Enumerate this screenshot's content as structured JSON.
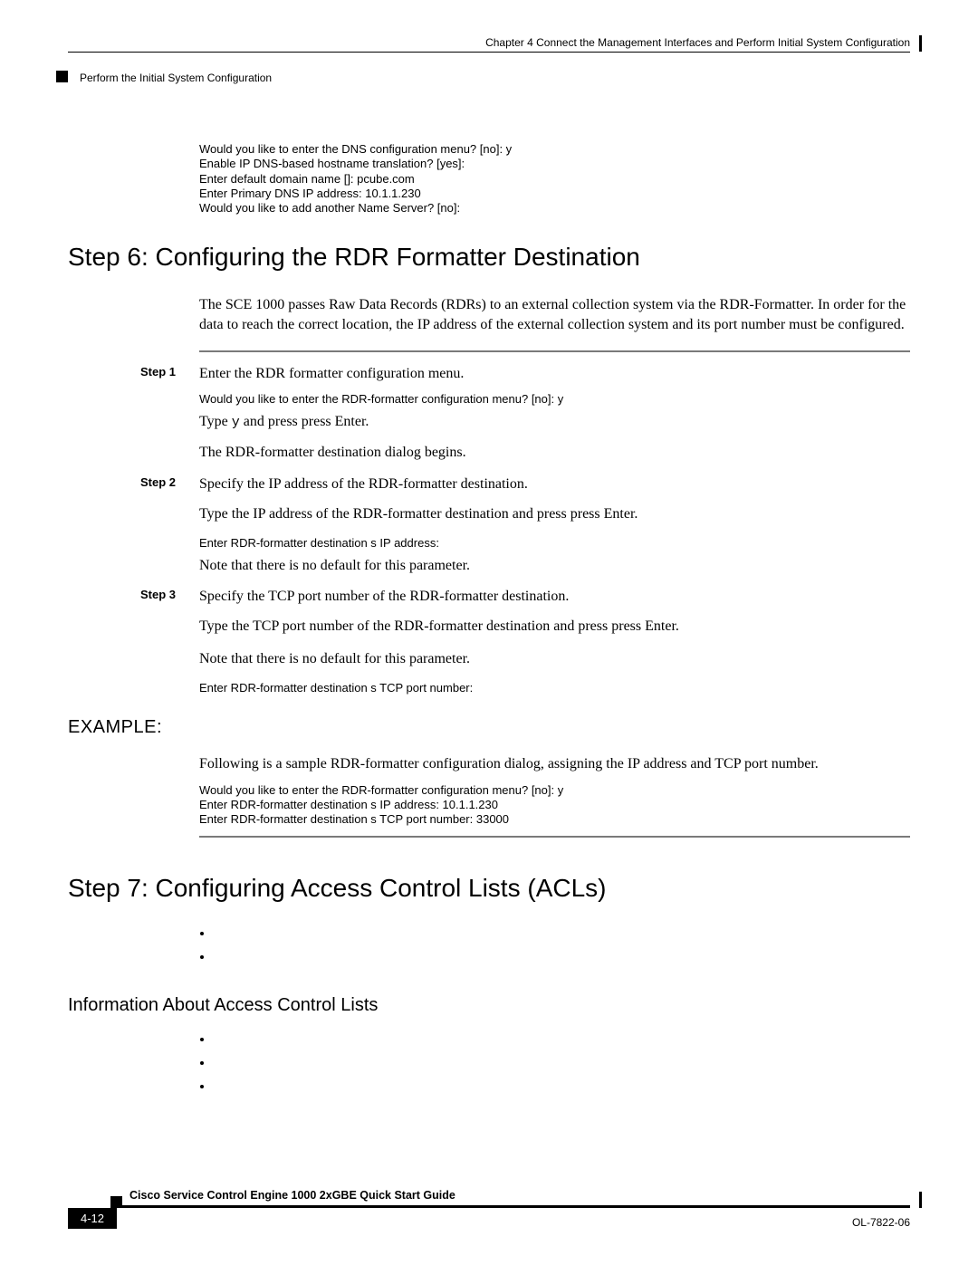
{
  "header": {
    "chapter": "Chapter 4    Connect the Management Interfaces and Perform Initial System Configuration",
    "section": "Perform the Initial System Configuration"
  },
  "intro_code": "Would you like to enter the DNS configuration menu? [no]: y\nEnable IP DNS-based hostname translation? [yes]:\nEnter default domain name []: pcube.com\nEnter Primary DNS IP address: 10.1.1.230\nWould you like to add another Name Server? [no]:",
  "step6": {
    "title": "Step 6: Configuring the RDR Formatter Destination",
    "intro": "The SCE 1000 passes Raw Data Records (RDRs) to an external collection system via the RDR-Formatter. In order for the data to reach the correct location, the IP address of the external collection system and its port number must be configured.",
    "s1": {
      "label": "Step 1",
      "text": "Enter the RDR formatter configuration menu.",
      "code": "Would you like to enter the RDR-formatter configuration menu? [no]: y",
      "type_prefix": "Type ",
      "type_mono": "y",
      "type_suffix": " and press press Enter.",
      "after": "The RDR-formatter destination dialog begins."
    },
    "s2": {
      "label": "Step 2",
      "text": "Specify the IP address of the RDR-formatter destination.",
      "line2": "Type the IP address of the RDR-formatter destination and press press Enter.",
      "code": "Enter RDR-formatter destination s IP address:",
      "note": "Note that there is no default for this parameter."
    },
    "s3": {
      "label": "Step 3",
      "text": "Specify the TCP port number of the RDR-formatter destination.",
      "line2": "Type the TCP port number of the RDR-formatter destination and press press Enter.",
      "note": "Note that there is no default for this parameter.",
      "code": "Enter RDR-formatter destination s TCP port number:"
    },
    "example_heading": "EXAMPLE:",
    "example_text": "Following is a sample RDR-formatter configuration dialog, assigning the IP address and TCP port number.",
    "example_code": "Would you like to enter the RDR-formatter configuration menu? [no]: y\nEnter RDR-formatter destination s IP address: 10.1.1.230\nEnter RDR-formatter destination s TCP port number: 33000"
  },
  "step7": {
    "title": "Step 7: Configuring Access Control Lists (ACLs)",
    "subheading": "Information About Access Control Lists"
  },
  "footer": {
    "guide": "Cisco Service Control Engine 1000 2xGBE Quick Start Guide",
    "page": "4-12",
    "docid": "OL-7822-06"
  }
}
